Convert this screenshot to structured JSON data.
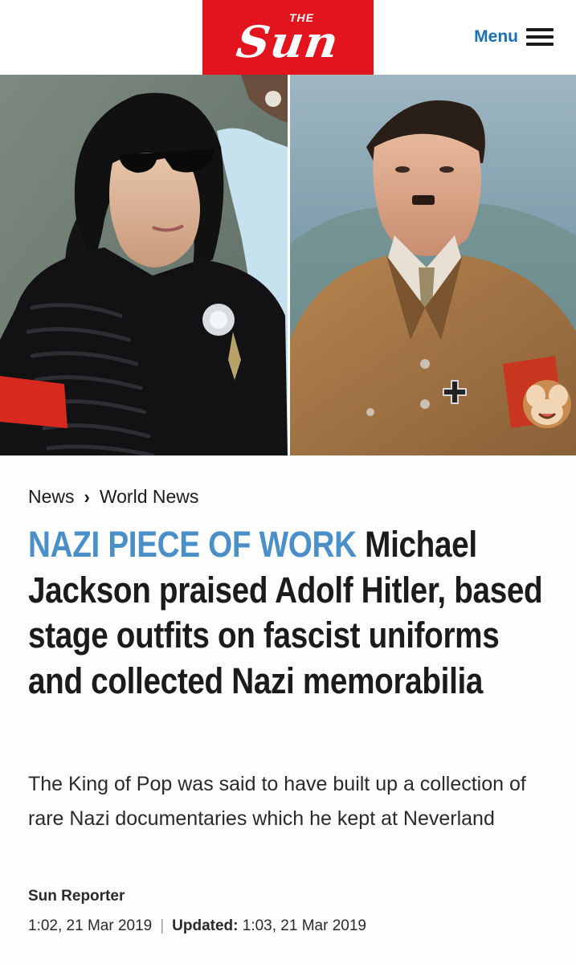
{
  "header": {
    "logo_small": "THE",
    "logo_main": "Sun",
    "menu_label": "Menu",
    "brand_color": "#e2141d",
    "accent_color": "#1a6fb5"
  },
  "breadcrumb": {
    "items": [
      "News",
      "World News"
    ]
  },
  "article": {
    "kicker": "NAZI PIECE OF WORK",
    "title": "Michael Jackson praised Adolf Hitler, based stage outfits on fascist uniforms and collected Nazi memorabilia",
    "standfirst": "The King of Pop was said to have built up a collection of rare Nazi documentaries which he kept at Neverland",
    "author": "Sun Reporter",
    "published": "1:02, 21 Mar 2019",
    "separator": "|",
    "updated_label": "Updated:",
    "updated": "1:03, 21 Mar 2019",
    "kicker_color": "#4a8fc8"
  }
}
